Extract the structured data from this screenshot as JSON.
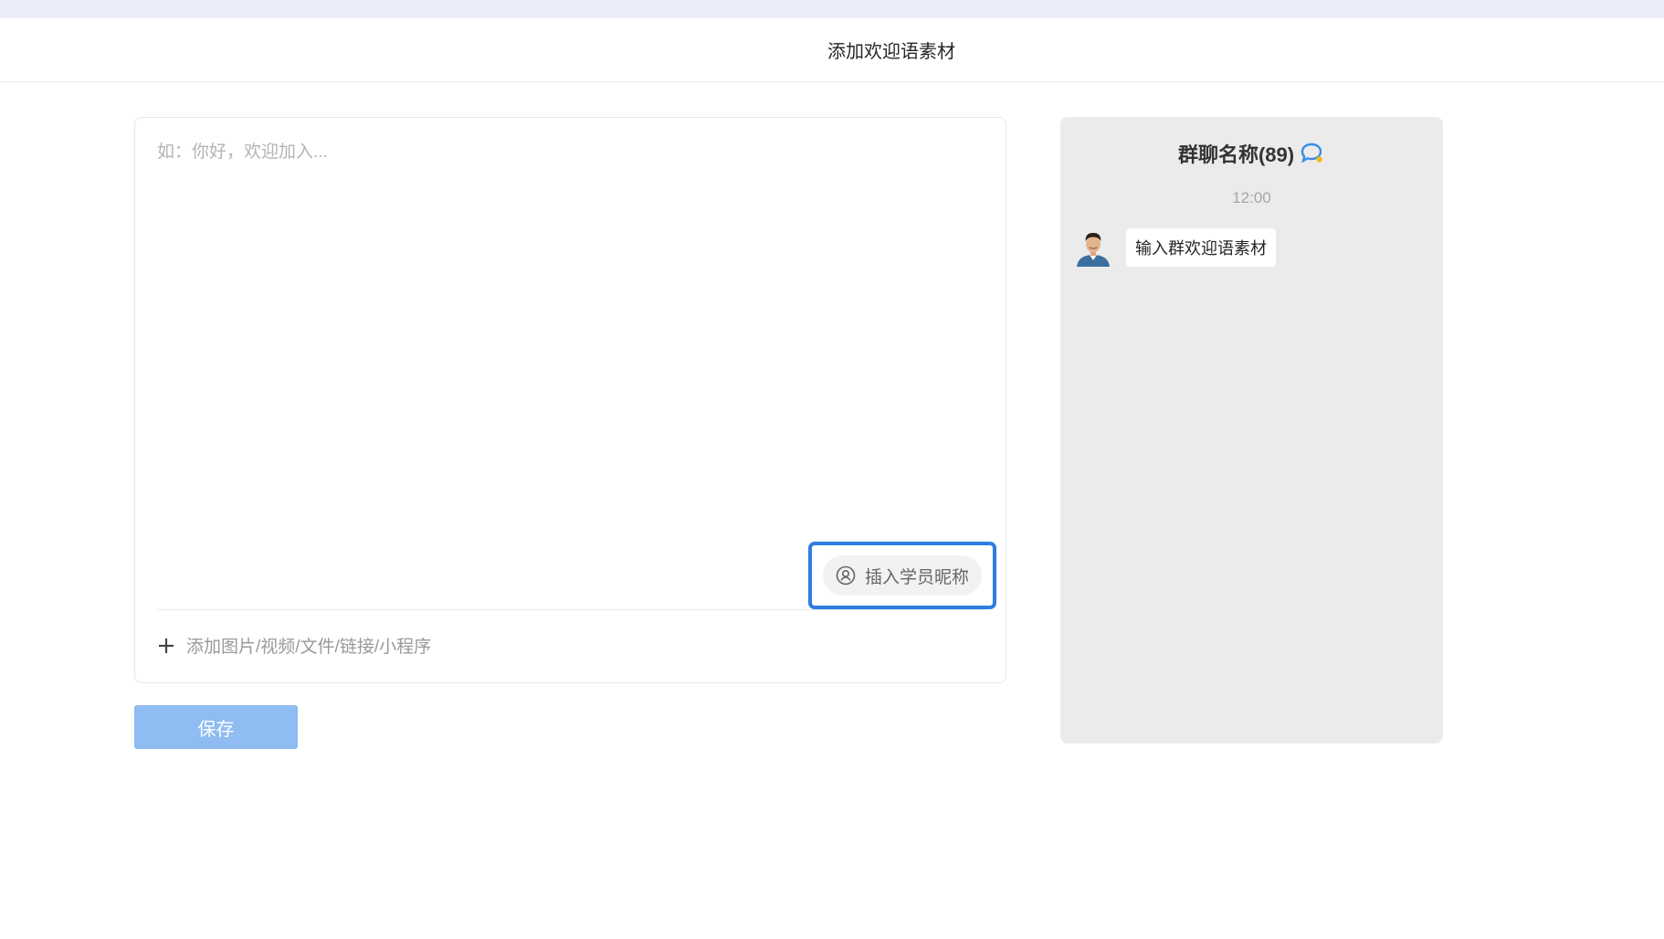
{
  "header": {
    "title": "添加欢迎语素材"
  },
  "editor": {
    "placeholder": "如：你好，欢迎加入...",
    "insert_label": "插入学员昵称",
    "add_media_label": "添加图片/视频/文件/链接/小程序"
  },
  "actions": {
    "save_label": "保存"
  },
  "preview": {
    "chat_title": "群聊名称(89)",
    "time": "12:00",
    "message": "输入群欢迎语素材"
  },
  "icons": {
    "insert": "user-circle-icon",
    "add": "plus-icon",
    "chat": "chat-bubble-icon",
    "avatar": "avatar"
  },
  "colors": {
    "accent": "#2f7de1",
    "save_button": "#8fbcf2",
    "preview_bg": "#ebebeb",
    "chat_icon": "#3a8ee6"
  }
}
